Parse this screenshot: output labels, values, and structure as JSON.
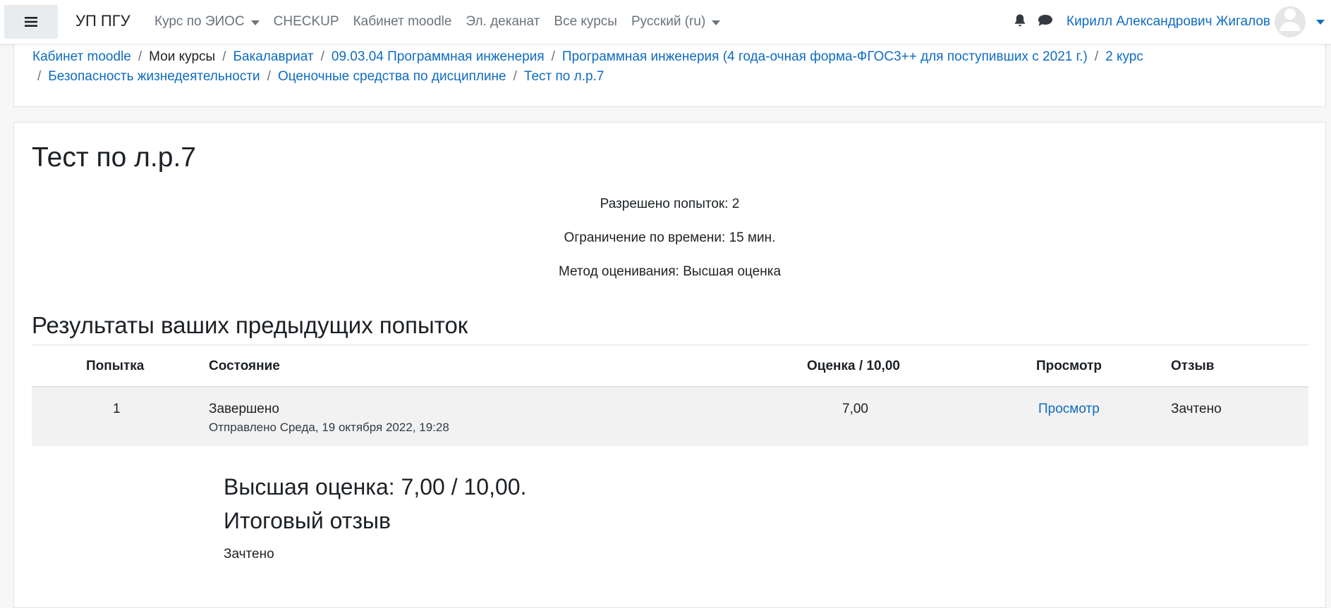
{
  "navbar": {
    "brand": "УП ПГУ",
    "menu": [
      {
        "label": "Курс по ЭИОС",
        "has_dropdown": true
      },
      {
        "label": "CHECKUP",
        "has_dropdown": false
      },
      {
        "label": "Кабинет moodle",
        "has_dropdown": false
      },
      {
        "label": "Эл. деканат",
        "has_dropdown": false
      },
      {
        "label": "Все курсы",
        "has_dropdown": false
      },
      {
        "label": "Русский (ru)",
        "has_dropdown": true
      }
    ],
    "user_name": "Кирилл Александрович Жигалов",
    "icons": [
      "menu-icon",
      "bell-icon",
      "chat-icon",
      "avatar-icon"
    ]
  },
  "breadcrumb": [
    {
      "label": "Кабинет moodle",
      "link": true
    },
    {
      "label": "Мои курсы",
      "link": false
    },
    {
      "label": "Бакалавриат",
      "link": true
    },
    {
      "label": "09.03.04 Программная инженерия",
      "link": true
    },
    {
      "label": "Программная инженерия (4 года-очная форма-ФГОС3++ для поступивших с 2021 г.)",
      "link": true
    },
    {
      "label": "2 курс",
      "link": true
    },
    {
      "label": "Безопасность жизнедеятельности",
      "link": true
    },
    {
      "label": "Оценочные средства по дисциплине",
      "link": true
    },
    {
      "label": "Тест по л.р.7",
      "link": true
    }
  ],
  "main": {
    "title": "Тест по л.р.7",
    "info": [
      "Разрешено попыток: 2",
      "Ограничение по времени: 15 мин.",
      "Метод оценивания: Высшая оценка"
    ],
    "results_heading": "Результаты ваших предыдущих попыток",
    "table": {
      "headers": [
        "Попытка",
        "Состояние",
        "Оценка / 10,00",
        "Просмотр",
        "Отзыв"
      ],
      "rows": [
        {
          "attempt": "1",
          "state": "Завершено",
          "submitted": "Отправлено Среда, 19 октября 2022, 19:28",
          "grade": "7,00",
          "review": "Просмотр",
          "feedback": "Зачтено"
        }
      ]
    },
    "highest_grade": "Высшая оценка: 7,00 / 10,00.",
    "overall_feedback_heading": "Итоговый отзыв",
    "overall_feedback": "Зачтено"
  },
  "colors": {
    "link": "#0f6cbf",
    "muted": "#6a737b",
    "text": "#1d2125",
    "row_bg": "#f2f2f2",
    "border": "#dee2e6"
  }
}
